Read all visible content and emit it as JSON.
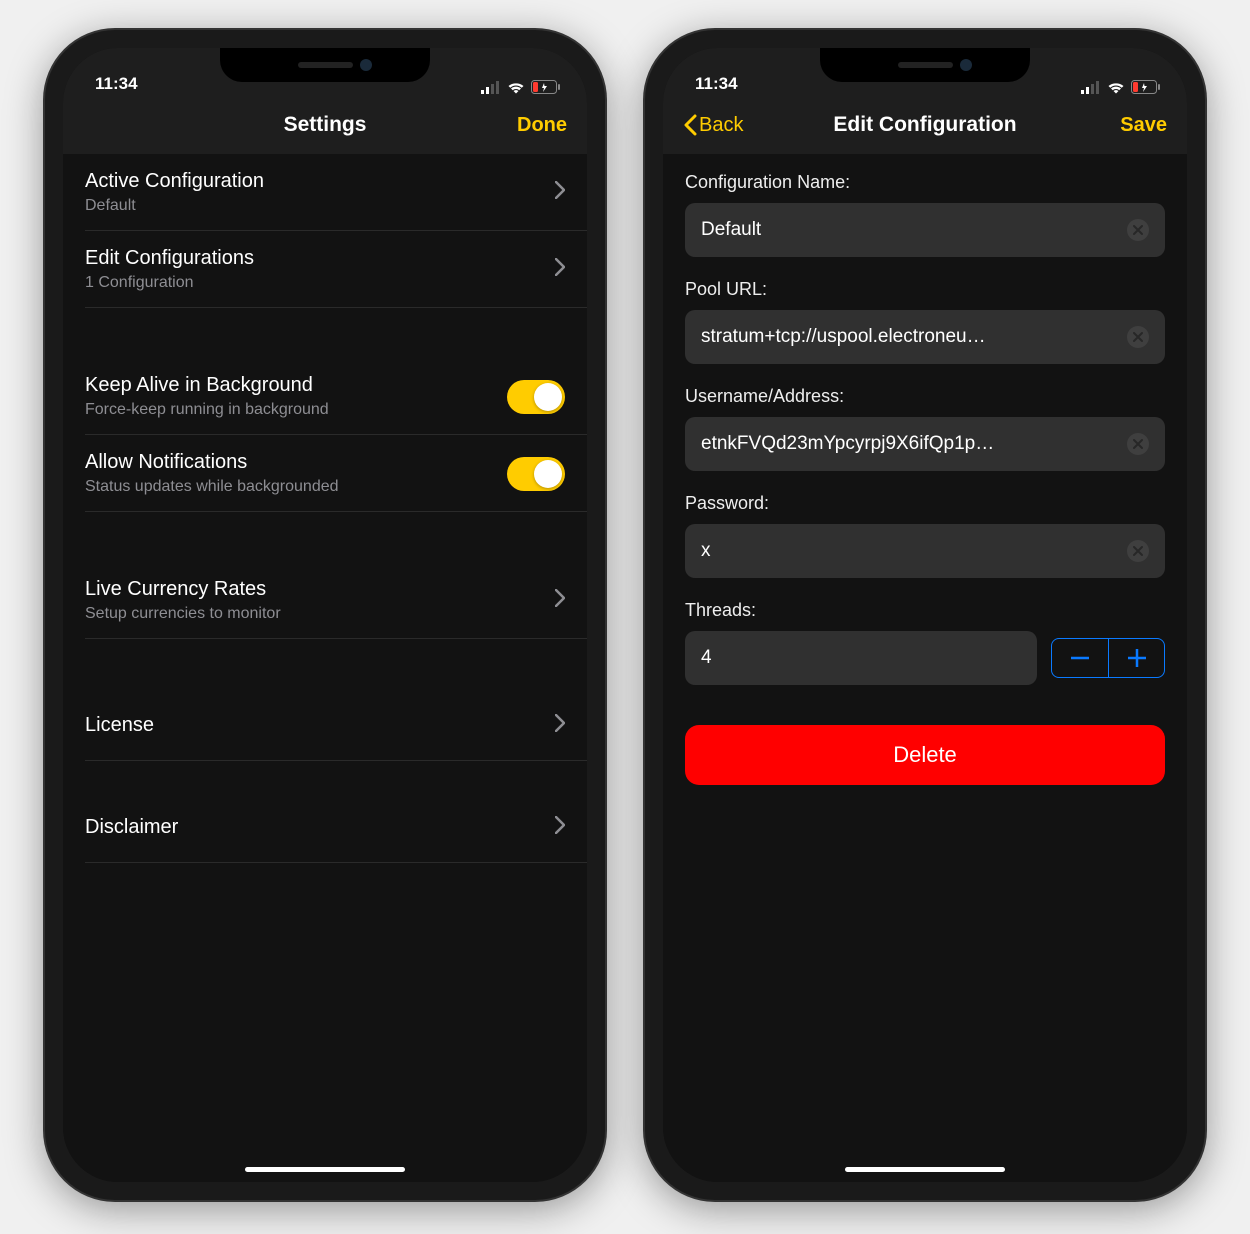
{
  "status": {
    "time": "11:34"
  },
  "left": {
    "nav": {
      "title": "Settings",
      "done": "Done"
    },
    "rows": {
      "active": {
        "title": "Active Configuration",
        "sub": "Default"
      },
      "editconfigs": {
        "title": "Edit Configurations",
        "sub": "1 Configuration"
      },
      "keepalive": {
        "title": "Keep Alive in Background",
        "sub": "Force-keep running in background"
      },
      "notifications": {
        "title": "Allow Notifications",
        "sub": "Status updates while backgrounded"
      },
      "rates": {
        "title": "Live Currency Rates",
        "sub": "Setup currencies to monitor"
      },
      "license": {
        "title": "License"
      },
      "disclaimer": {
        "title": "Disclaimer"
      }
    }
  },
  "right": {
    "nav": {
      "back": "Back",
      "title": "Edit Configuration",
      "save": "Save"
    },
    "form": {
      "name_label": "Configuration Name:",
      "name_value": "Default",
      "pool_label": "Pool URL:",
      "pool_value": "stratum+tcp://uspool.electroneu…",
      "user_label": "Username/Address:",
      "user_value": "etnkFVQd23mYpcyrpj9X6ifQp1p…",
      "pass_label": "Password:",
      "pass_value": "x",
      "threads_label": "Threads:",
      "threads_value": "4",
      "delete": "Delete"
    }
  }
}
